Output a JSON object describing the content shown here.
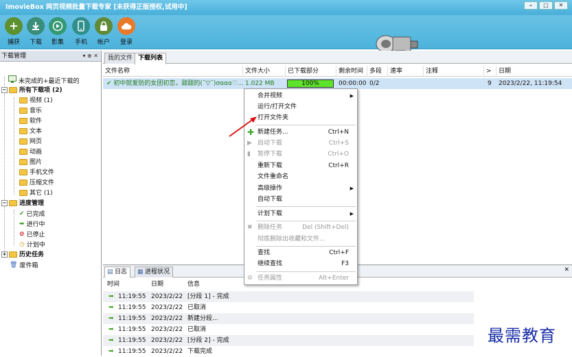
{
  "app": {
    "title": "ImovieBox 网页视频批量下载专家 [未获得正版授权,试用中]"
  },
  "toolbar": {
    "items": [
      {
        "label": "捕获",
        "icon": "plus-icon",
        "color": "#5d9130"
      },
      {
        "label": "下载",
        "icon": "download-icon",
        "color": "#3a8d78"
      },
      {
        "label": "影集",
        "icon": "play-icon",
        "color": "#349873"
      },
      {
        "label": "手机",
        "icon": "phone-icon",
        "color": "#2f8f8a"
      },
      {
        "label": "帐户",
        "icon": "lock-icon",
        "color": "#5f8a38"
      },
      {
        "label": "登录",
        "icon": "cloud-icon",
        "color": "#e97a2b"
      }
    ]
  },
  "left_panel": {
    "title": "下载管理",
    "tree": [
      {
        "label": "未完成的+最近下载的",
        "icon": "monitor-icon"
      },
      {
        "label": "所有下载项 (2)",
        "bold": true
      },
      {
        "label": "视频 (1)"
      },
      {
        "label": "音乐"
      },
      {
        "label": "软件"
      },
      {
        "label": "文本"
      },
      {
        "label": "网页"
      },
      {
        "label": "动画"
      },
      {
        "label": "图片"
      },
      {
        "label": "手机文件"
      },
      {
        "label": "压缩文件"
      },
      {
        "label": "其它 (1)"
      },
      {
        "label": "进度管理",
        "bold": true
      },
      {
        "label": "已完成",
        "icon": "check-icon"
      },
      {
        "label": "进行中",
        "icon": "arrow-right-icon"
      },
      {
        "label": "已停止",
        "icon": "stop-icon"
      },
      {
        "label": "计划中",
        "icon": "clock-icon"
      },
      {
        "label": "历史任务",
        "bold": true
      },
      {
        "label": "废件箱",
        "icon": "trash-icon"
      }
    ]
  },
  "tabs": [
    "我的文件",
    "下载列表"
  ],
  "columns": [
    "文件名称",
    "文件大小",
    "已下载部分",
    "剩余时间",
    "多段",
    "速率",
    "注释",
    ">",
    "日期"
  ],
  "download_row": {
    "name": "初中就爱防的女团初恋，甜甜的(˘▽˘)σααα♡...",
    "size": "1.022 MB",
    "progress": "100%",
    "remaining": "00:00:00",
    "segments": "0/2",
    "rate": "",
    "note": "",
    "count": "9",
    "date": "2023/2/22, 11:19:54"
  },
  "context_menu": [
    {
      "label": "合并视频",
      "submenu": true
    },
    {
      "label": "运行/打开文件"
    },
    {
      "label": "打开文件夹"
    },
    {
      "sep": true
    },
    {
      "label": "新建任务...",
      "shortcut": "Ctrl+N",
      "icon": "plus-icon"
    },
    {
      "label": "启动下载",
      "shortcut": "Ctrl+S",
      "disabled": true,
      "icon": "play-icon"
    },
    {
      "label": "暂停下载",
      "shortcut": "Ctrl+O",
      "disabled": true,
      "icon": "pause-icon"
    },
    {
      "label": "重新下载",
      "shortcut": "Ctrl+R"
    },
    {
      "label": "文件重命名"
    },
    {
      "label": "高级操作",
      "submenu": true
    },
    {
      "label": "自动下载"
    },
    {
      "sep": true
    },
    {
      "label": "计划下载",
      "submenu": true
    },
    {
      "sep": true
    },
    {
      "label": "删除任务",
      "shortcut": "Del (Shift+Del)",
      "disabled": true,
      "icon": "x-icon"
    },
    {
      "label": "彻底删除出收藏和文件...",
      "disabled": true
    },
    {
      "sep": true
    },
    {
      "label": "查找",
      "shortcut": "Ctrl+F"
    },
    {
      "label": "继续查找",
      "shortcut": "F3"
    },
    {
      "sep": true
    },
    {
      "label": "任务属性",
      "shortcut": "Alt+Enter",
      "disabled": true,
      "icon": "properties-icon"
    }
  ],
  "bottom_tabs": [
    "日志",
    "进程状况"
  ],
  "log_columns": [
    "时间",
    "日期",
    "信息"
  ],
  "log_rows": [
    {
      "time": "11:19:55",
      "date": "2023/2/22",
      "info": "[分段 1] - 完成"
    },
    {
      "time": "11:19:55",
      "date": "2023/2/22",
      "info": "已取消"
    },
    {
      "time": "11:19:55",
      "date": "2023/2/22",
      "info": "新建分段..."
    },
    {
      "time": "11:19:55",
      "date": "2023/2/22",
      "info": "已取消"
    },
    {
      "time": "11:19:55",
      "date": "2023/2/22",
      "info": "[分段 2] - 完成"
    },
    {
      "time": "11:19:55",
      "date": "2023/2/22",
      "info": "下载完成"
    }
  ],
  "watermark": "最需教育"
}
